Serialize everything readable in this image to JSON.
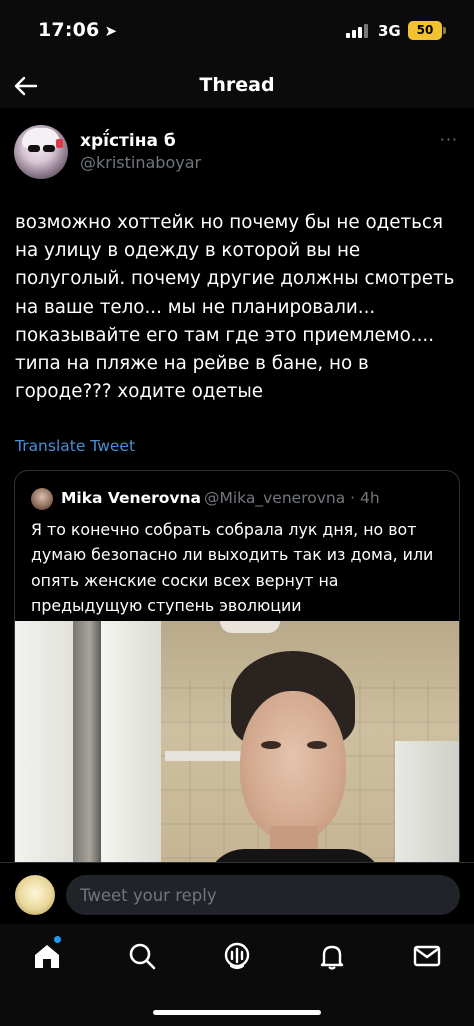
{
  "status_bar": {
    "time": "17:06",
    "location_glyph": "➤",
    "network": "3G",
    "battery_level": "50"
  },
  "header": {
    "title": "Thread",
    "back_icon": "arrow-left-icon"
  },
  "tweet": {
    "author_name": "хрї́стіна б",
    "author_handle": "@kristinaboyar",
    "more_glyph": "···",
    "text": "возможно хоттейк но почему бы не одеться\nна улицу в одежду в которой вы не\nполуголый. почему другие должны смотреть\nна ваше тело... мы не планировали...\nпоказывайте его там где это приемлемо....\nтипа на пляже на рейве в бане, но в\nгороде??? ходите одетые",
    "translate_label": "Translate Tweet"
  },
  "quote": {
    "author_name": "Mika Venerovna",
    "author_handle": "@Mika_venerovna · 4h",
    "text": "Я то конечно собрать собрала лук дня, но вот\nдумаю безопасно ли выходить так из дома, или\nопять женские соски всех вернут на\nпредыдущую ступень эволюции"
  },
  "reply": {
    "placeholder": "Tweet your reply"
  },
  "bottom_nav": {
    "items": [
      {
        "icon": "home-icon",
        "active": true
      },
      {
        "icon": "search-icon"
      },
      {
        "icon": "spaces-icon"
      },
      {
        "icon": "notifications-icon"
      },
      {
        "icon": "messages-icon"
      }
    ]
  },
  "colors": {
    "background": "#000000",
    "link": "#4a8fd6",
    "secondary_text": "#71767b",
    "accent": "#1d9bf0",
    "battery": "#f3c230"
  }
}
